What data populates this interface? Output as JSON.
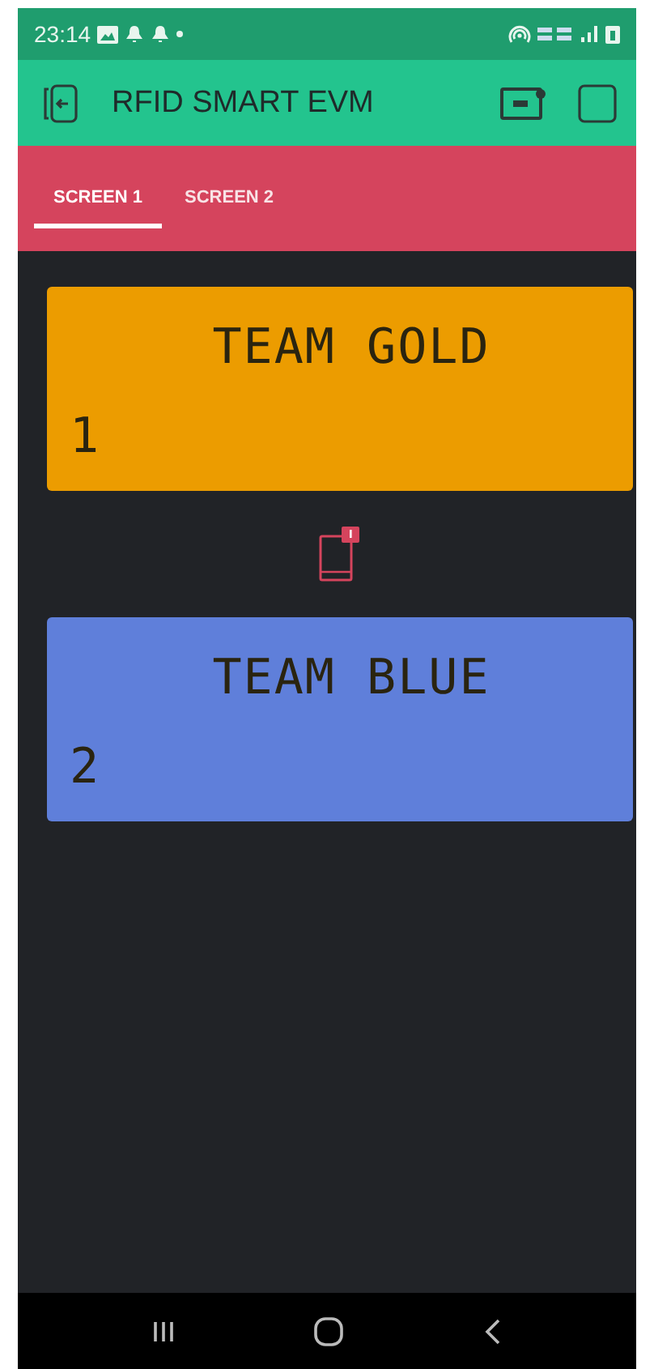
{
  "status_bar": {
    "time": "23:14"
  },
  "app_bar": {
    "title": "RFID SMART EVM"
  },
  "tabs": [
    {
      "label": "SCREEN 1",
      "selected": true
    },
    {
      "label": "SCREEN 2",
      "selected": false
    }
  ],
  "displays": [
    {
      "line_1": "TEAM GOLD",
      "line_2": "1",
      "color": "#ec9c00"
    },
    {
      "line_1": "TEAM BLUE",
      "line_2": "2",
      "color": "#5f7fda"
    }
  ]
}
